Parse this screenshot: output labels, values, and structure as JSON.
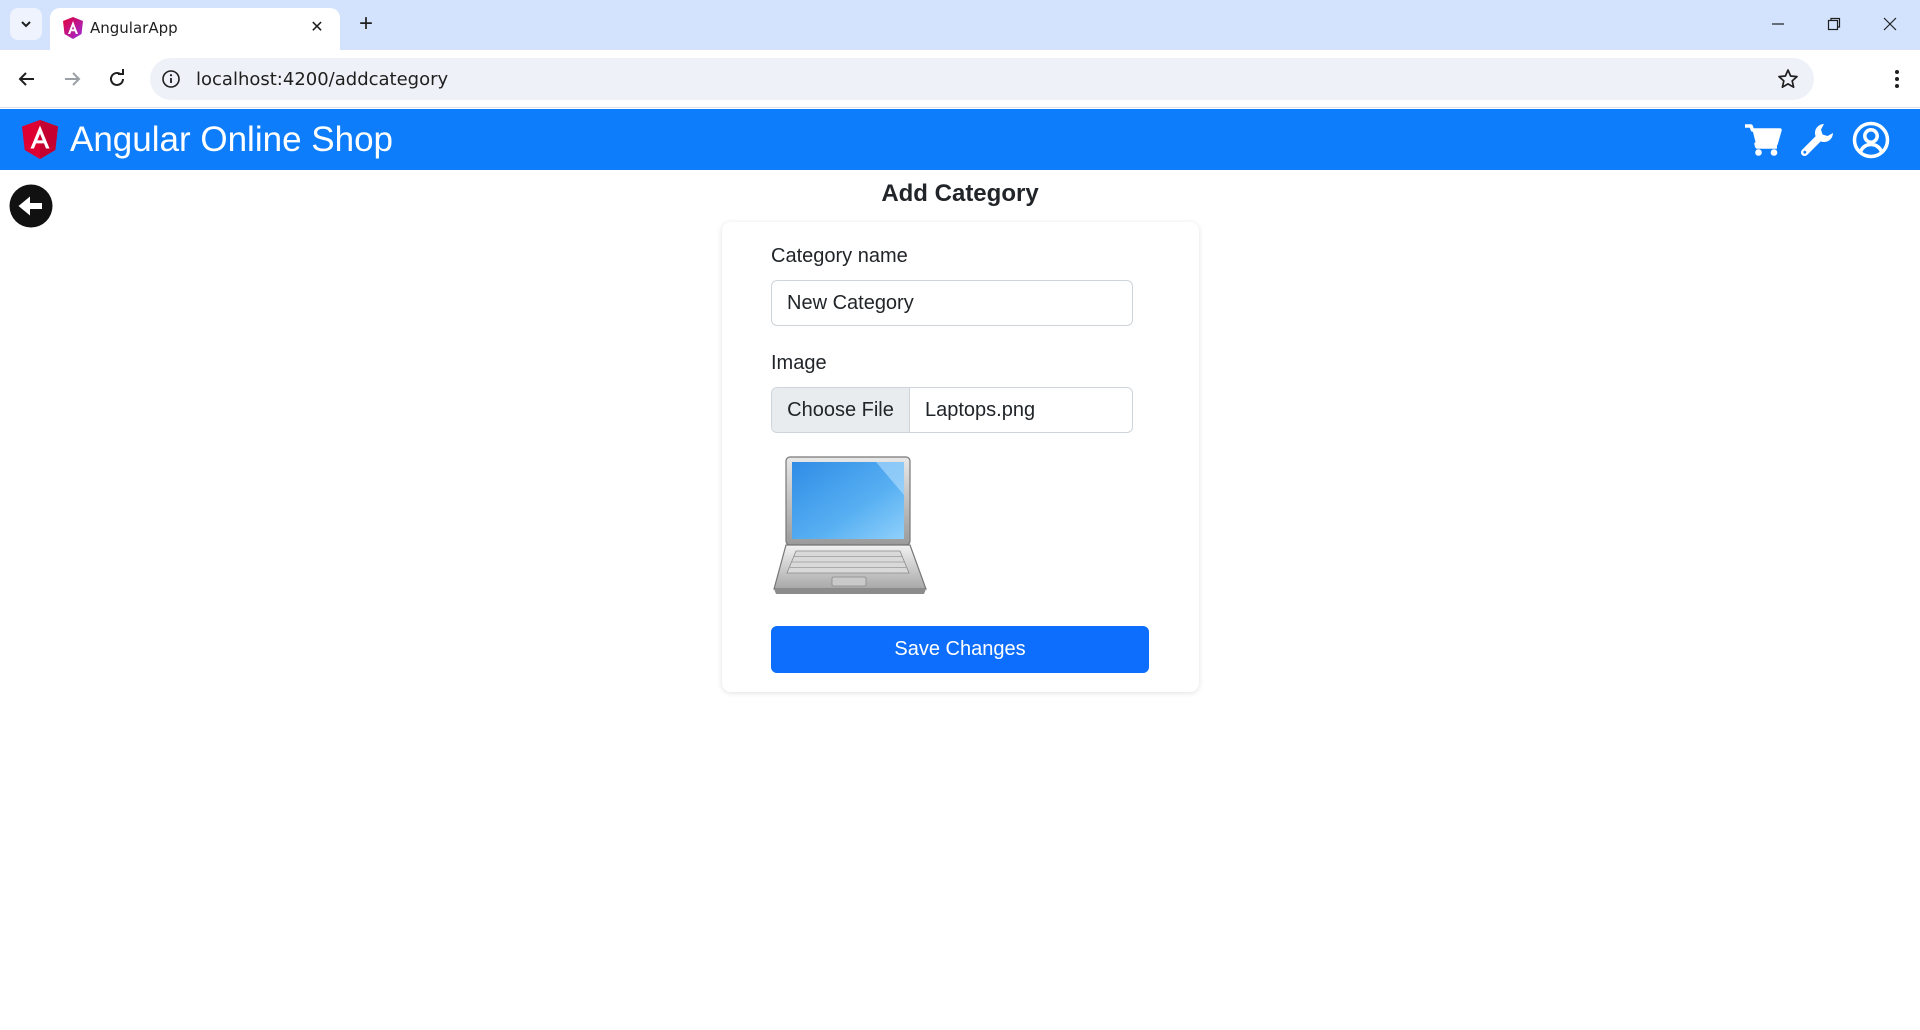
{
  "browser": {
    "tab_title": "AngularApp",
    "close_glyph": "✕",
    "new_tab_glyph": "+",
    "url": "localhost:4200/addcategory",
    "icons": [
      "tab-list-icon",
      "angular-favicon-icon",
      "close-icon",
      "plus-icon",
      "minimize-icon",
      "restore-icon",
      "window-close-icon",
      "back-arrow-icon",
      "forward-arrow-icon",
      "reload-icon",
      "info-icon",
      "star-icon",
      "kebab-menu-icon"
    ]
  },
  "navbar": {
    "brand": "Angular Online Shop",
    "background": "#0d7dfc",
    "icons": [
      "cart-icon",
      "wrench-icon",
      "user-circle-icon"
    ]
  },
  "page": {
    "title": "Add Category"
  },
  "form": {
    "category_label": "Category name",
    "category_value": "New Category",
    "image_label": "Image",
    "file_button": "Choose File",
    "file_name": "Laptops.png",
    "save_label": "Save Changes",
    "save_color": "#0d6efd"
  }
}
